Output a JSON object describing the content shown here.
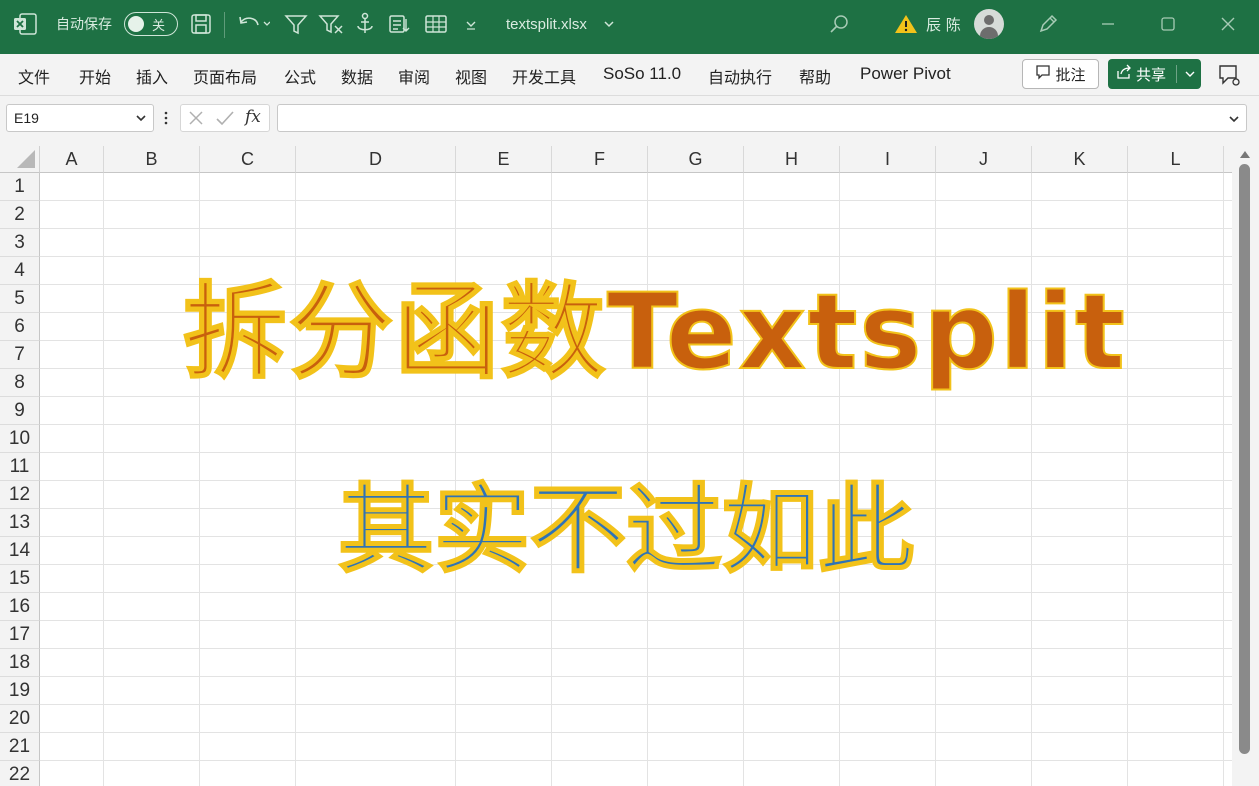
{
  "titlebar": {
    "autosave_label": "自动保存",
    "autosave_state": "关",
    "filename": "textsplit.xlsx",
    "user_name": "辰 陈",
    "bg_color": "#1e7144"
  },
  "ribbon": {
    "tabs": [
      "文件",
      "开始",
      "插入",
      "页面布局",
      "公式",
      "数据",
      "审阅",
      "视图",
      "开发工具",
      "SoSo 11.0",
      "自动执行",
      "帮助",
      "Power Pivot"
    ],
    "comment_label": "批注",
    "share_label": "共享"
  },
  "formula_bar": {
    "name_box": "E19",
    "fx_label": "fx",
    "formula": ""
  },
  "grid": {
    "columns": [
      "A",
      "B",
      "C",
      "D",
      "E",
      "F",
      "G",
      "H",
      "I",
      "J",
      "K",
      "L"
    ],
    "rows": [
      "1",
      "2",
      "3",
      "4",
      "5",
      "6",
      "7",
      "8",
      "9",
      "10",
      "11",
      "12",
      "13",
      "14",
      "15",
      "16",
      "17",
      "18",
      "19",
      "20",
      "21",
      "22"
    ]
  },
  "overlay": {
    "headline": "拆分函数Textsplit",
    "subline": "其实不过如此",
    "headline_color": "#c8600d",
    "subline_color": "#2f73b6",
    "outline_color": "#f2c21a"
  }
}
